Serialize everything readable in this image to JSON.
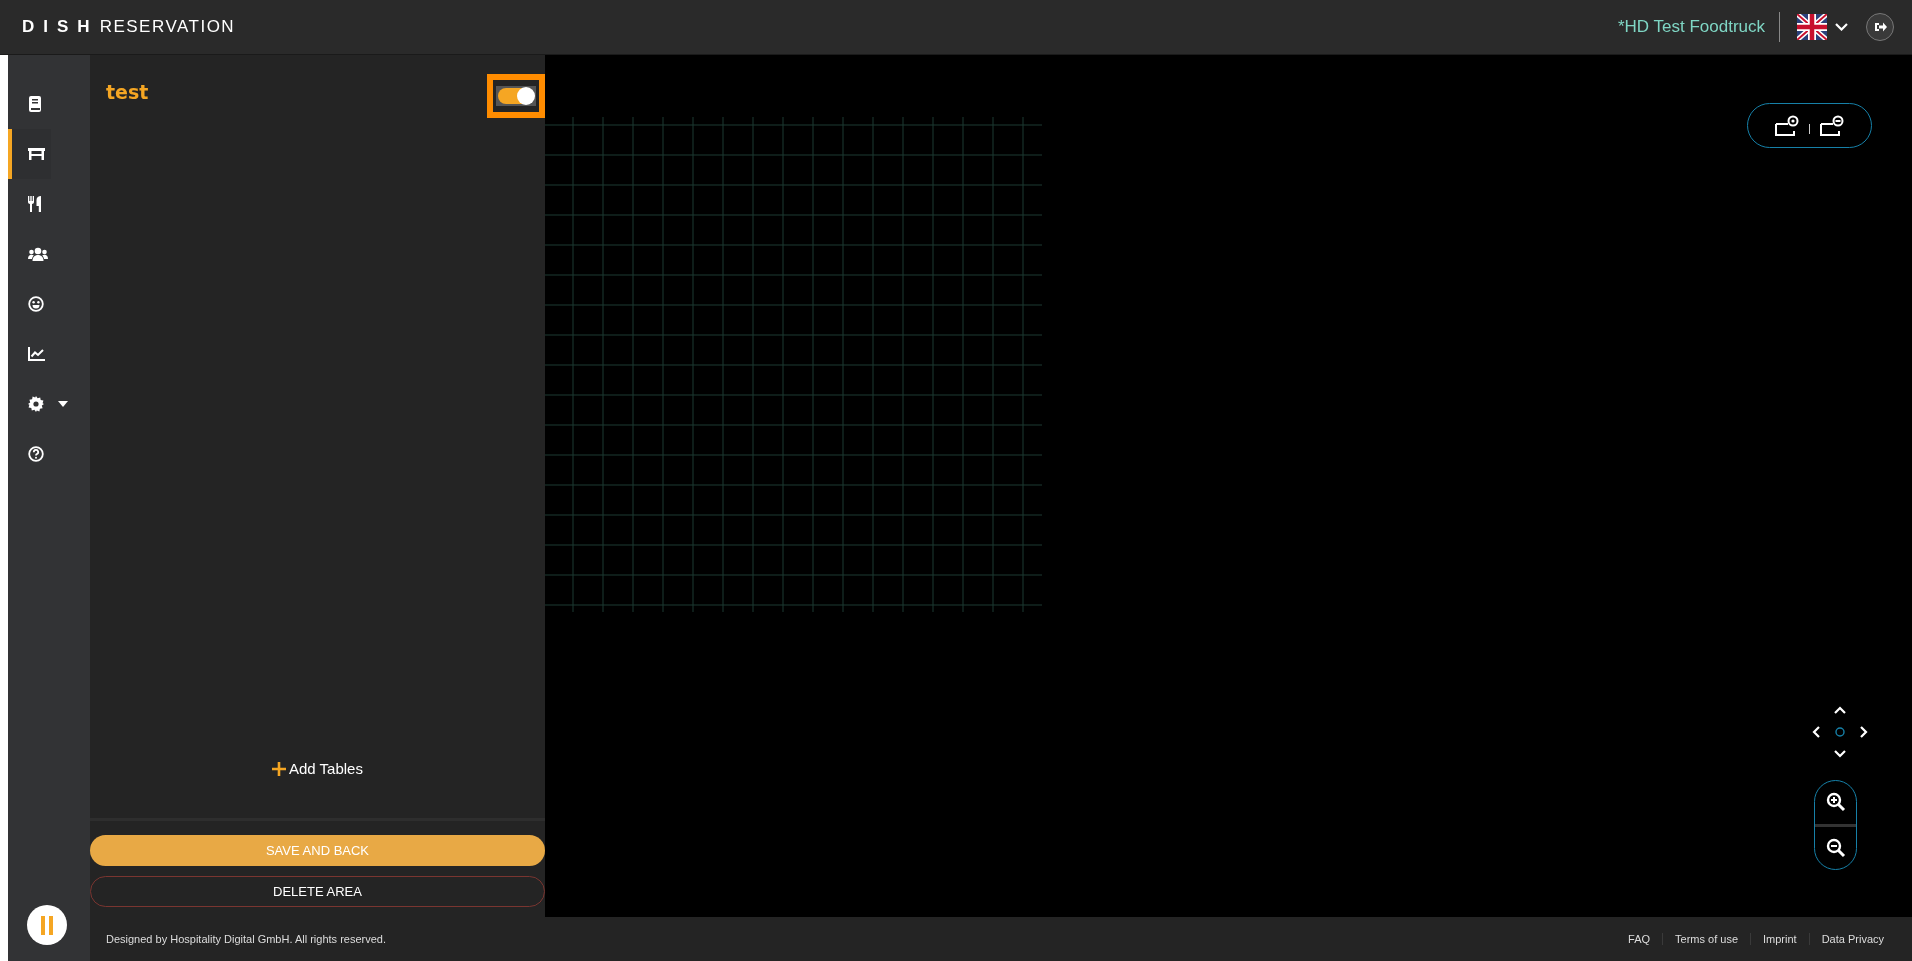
{
  "header": {
    "brand_mark": "DISH",
    "brand_name": "RESERVATION",
    "restaurant": "*HD Test Foodtruck"
  },
  "nav": [
    {
      "kind": "book",
      "selected": false,
      "expandable": false
    },
    {
      "kind": "table",
      "selected": true,
      "expandable": false
    },
    {
      "kind": "utensils",
      "selected": false,
      "expandable": false
    },
    {
      "kind": "users",
      "selected": false,
      "expandable": false
    },
    {
      "kind": "smile",
      "selected": false,
      "expandable": false
    },
    {
      "kind": "chart",
      "selected": false,
      "expandable": false
    },
    {
      "kind": "gear",
      "selected": false,
      "expandable": true
    },
    {
      "kind": "help",
      "selected": false,
      "expandable": false
    }
  ],
  "panel": {
    "title": "test",
    "toggle": {
      "on": true,
      "highlighted": true
    },
    "add_button": "Add Tables",
    "save_button": "SAVE AND BACK",
    "delete_button": "DELETE AREA"
  },
  "footer": {
    "copyright": "Designed by Hospitality Digital GmbH. All rights reserved.",
    "links": [
      "FAQ",
      "Terms of use",
      "Imprint",
      "Data Privacy"
    ]
  }
}
